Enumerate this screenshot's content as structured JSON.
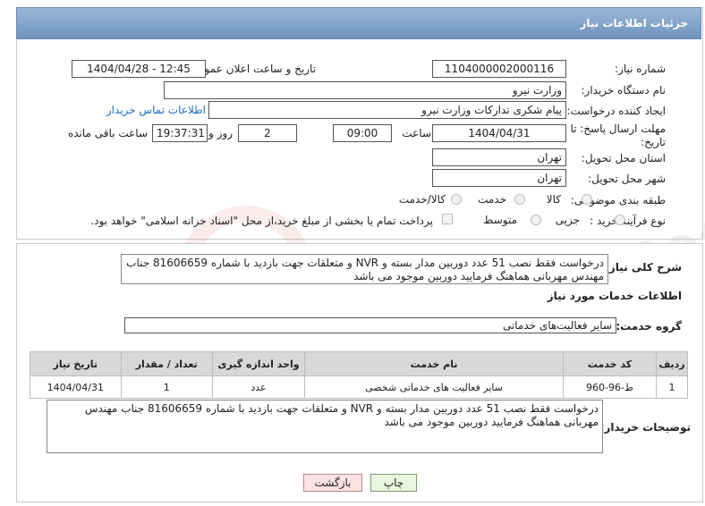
{
  "header": {
    "title": "جزئیات اطلاعات نیاز"
  },
  "form": {
    "need_number_label": "شماره نیاز:",
    "need_number": "1104000002000116",
    "announce_label": "تاریخ و ساعت اعلان عمومی:",
    "announce_value": "1404/04/28 - 12:45",
    "buyer_org_label": "نام دستگاه خریدار:",
    "buyer_org": "وزارت نیرو",
    "creator_label": "ایجاد کننده درخواست:",
    "creator": "پیام شکری تدارکات وزارت نیرو",
    "contact_link": "اطلاعات تماس خریدار",
    "deadline_label": "مهلت ارسال پاسخ: تا تاریخ:",
    "deadline_date": "1404/04/31",
    "time_label": "ساعت",
    "deadline_time": "09:00",
    "days_value": "2",
    "days_label": "روز و",
    "remaining_time": "19:37:31",
    "remaining_label": "ساعت باقی مانده",
    "province_label": "استان محل تحویل:",
    "province": "تهران",
    "city_label": "شهر محل تحویل:",
    "city": "تهران",
    "category_label": "طبقه بندی موضوعی:",
    "category_options": [
      "کالا",
      "خدمت",
      "کالا/خدمت"
    ],
    "process_label": "نوع فرآیند خرید :",
    "process_options": [
      "جزیی",
      "متوسط"
    ],
    "payment_note": "پرداخت تمام یا بخشی از مبلغ خرید،از محل \"اسناد خزانه اسلامی\" خواهد بود."
  },
  "details": {
    "summary_label": "شرح کلی نیاز:",
    "summary_text": "درخواست فقط نصب 51 عدد دوربین مدار بسته و NVR و متعلقات جهت بازدید با شماره 81606659 جناب مهندس مهربانی هماهنگ فرمایید  دوربین موجود می باشد",
    "services_title": "اطلاعات خدمات مورد نیاز",
    "service_group_label": "گروه خدمت:",
    "service_group": "سایر فعالیت‌های خدماتی",
    "table": {
      "headers": [
        "ردیف",
        "کد خدمت",
        "نام خدمت",
        "واحد اندازه گیری",
        "تعداد / مقدار",
        "تاریخ نیاز"
      ],
      "rows": [
        [
          "1",
          "ط-96-960",
          "سایر فعالیت های خدماتی شخصی",
          "عدد",
          "1",
          "1404/04/31"
        ]
      ]
    },
    "buyer_notes_label": "توضیحات خریدار:",
    "buyer_notes": "درخواست فقط نصب 51 عدد دوربین مدار بسته و NVR و متعلقات جهت بازدید با شماره 81606659 جناب مهندس مهربانی هماهنگ فرمایید  دوربین موجود می باشد"
  },
  "buttons": {
    "print": "چاپ",
    "back": "بازگشت"
  },
  "watermark": "AriaTender.net"
}
